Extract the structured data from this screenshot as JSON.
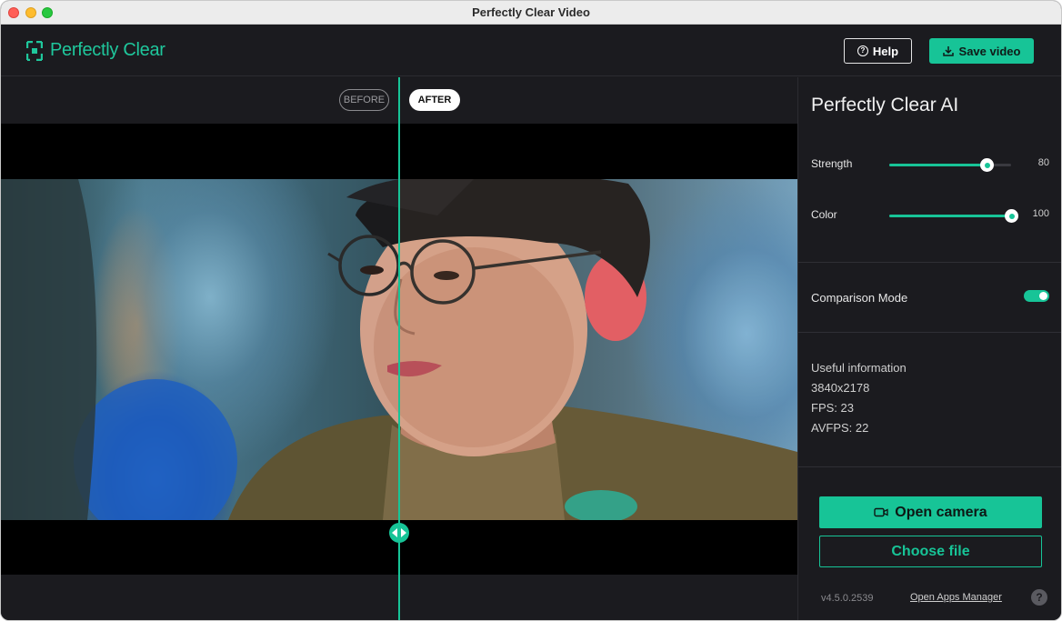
{
  "window": {
    "title": "Perfectly Clear Video"
  },
  "header": {
    "logo_text": "Perfectly Clear",
    "help_label": "Help",
    "save_label": "Save video"
  },
  "preview": {
    "before_label": "BEFORE",
    "after_label": "AFTER"
  },
  "sidebar": {
    "title": "Perfectly Clear AI",
    "sliders": [
      {
        "label": "Strength",
        "value": "80",
        "fraction": 0.8
      },
      {
        "label": "Color",
        "value": "100",
        "fraction": 1.0
      }
    ],
    "comparison_mode": {
      "label": "Comparison Mode",
      "enabled": true
    },
    "info": {
      "heading": "Useful information",
      "resolution": "3840x2178",
      "fps": "FPS: 23",
      "avfps": "AVFPS: 22"
    },
    "open_camera_label": "Open camera",
    "choose_file_label": "Choose file",
    "version": "v4.5.0.2539",
    "apps_manager_label": "Open Apps Manager",
    "help_glyph": "?"
  },
  "colors": {
    "accent": "#17c497",
    "background": "#1b1b1f"
  },
  "icons": [
    "logo-icon",
    "question-icon",
    "download-icon",
    "camera-icon",
    "split-arrows-icon"
  ]
}
